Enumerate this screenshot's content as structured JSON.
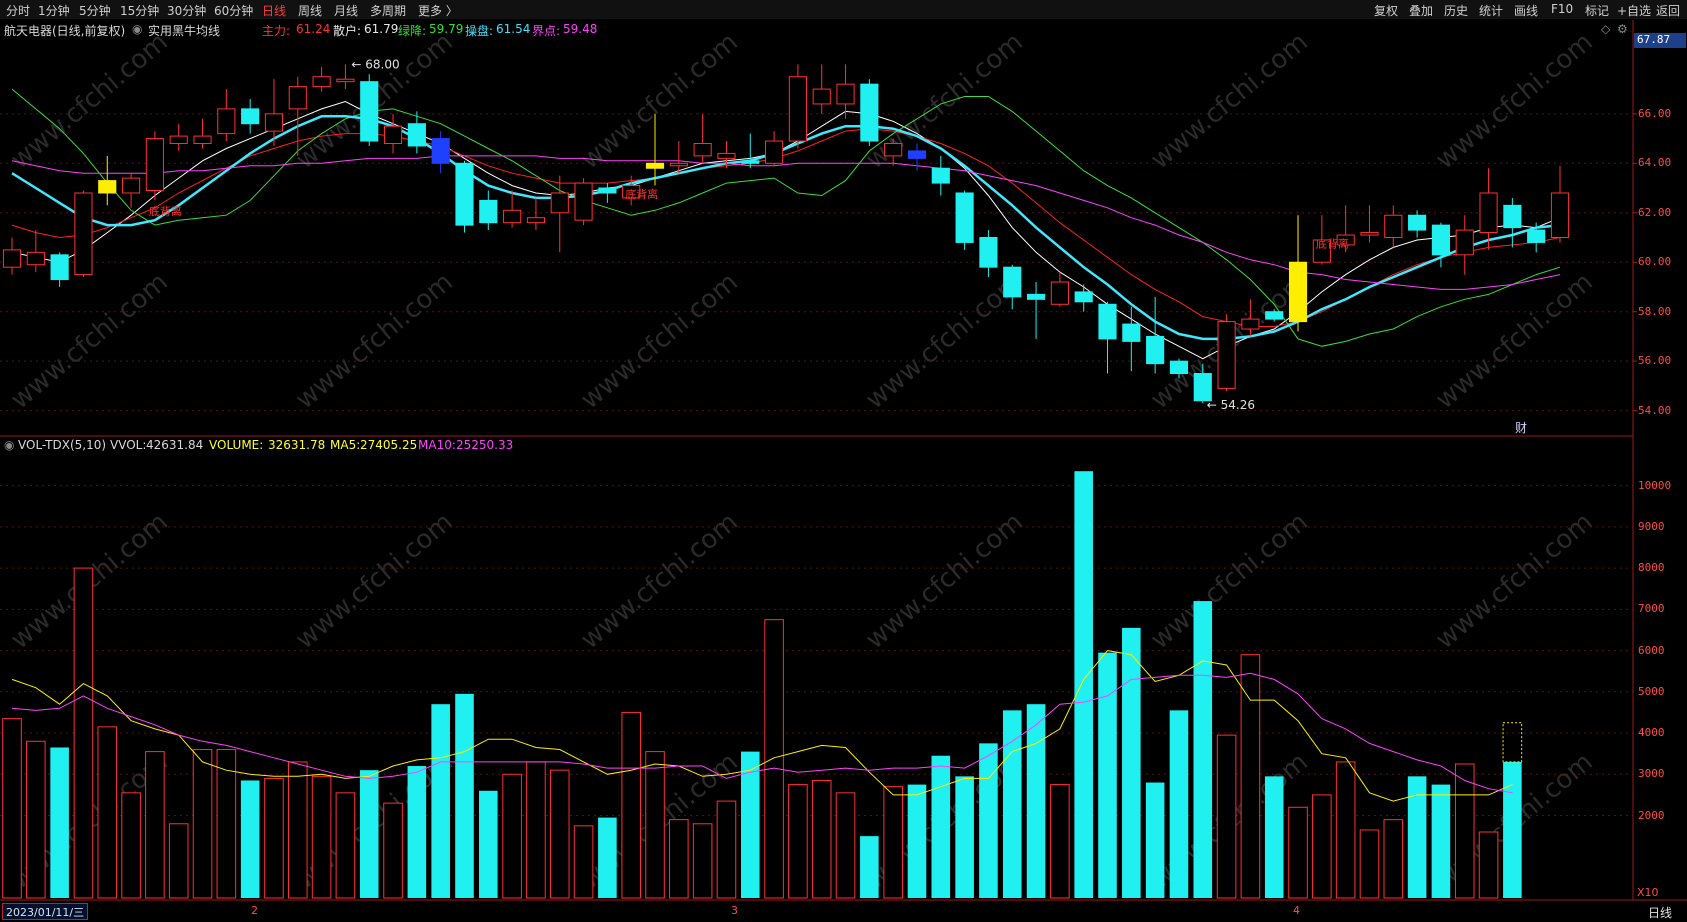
{
  "toolbar": {
    "periods": [
      "分时",
      "1分钟",
      "5分钟",
      "15分钟",
      "30分钟",
      "60分钟",
      "日线",
      "周线",
      "月线",
      "多周期",
      "更多 〉"
    ],
    "active_period": "日线",
    "right_buttons": [
      "复权",
      "叠加",
      "历史",
      "统计",
      "画线",
      "F10",
      "标记",
      "+自选",
      "返回"
    ]
  },
  "info": {
    "stock": "航天电器(日线,前复权)",
    "indicator": "实用黑牛均线",
    "zhuli_label": "主力:",
    "zhuli": "61.24",
    "sanhu_label": "散户:",
    "sanhu": "61.79",
    "lvjiang_label": "绿降:",
    "lvjiang": "59.79",
    "caopan_label": "操盘:",
    "caopan": "61.54",
    "jiedian_label": "界点:",
    "jiedian": "59.48"
  },
  "price_axis": {
    "last_price": "67.87",
    "ticks": [
      "66.00",
      "64.00",
      "62.00",
      "60.00",
      "58.00",
      "56.00",
      "54.00"
    ],
    "high_label": "68.00",
    "low_label": "54.26",
    "cai_badge": "财"
  },
  "signals": [
    "底背离",
    "底背离",
    "底背离"
  ],
  "volume": {
    "title": "VOL-TDX(5,10)",
    "vvol_label": "VVOL:",
    "vvol": "42631.84",
    "volume_label": "VOLUME:",
    "volume_value": "32631.78",
    "ma5_label": "MA5:",
    "ma5": "27405.25",
    "ma10_label": "MA10:",
    "ma10": "25250.33",
    "ticks": [
      "10000",
      "9000",
      "8000",
      "7000",
      "6000",
      "5000",
      "4000",
      "3000",
      "2000"
    ],
    "unit": "X10"
  },
  "xaxis": {
    "date": "2023/01/11/三",
    "months": [
      "2",
      "3",
      "4"
    ]
  },
  "period_label": "日线",
  "watermark": "www.cfchi.com",
  "chart_data": {
    "type": "candlestick",
    "title": "航天电器(日线,前复权)",
    "ylim": [
      53.5,
      68.5
    ],
    "candles": [
      {
        "o": 59.8,
        "c": 60.5,
        "h": 61.0,
        "l": 59.5
      },
      {
        "o": 59.9,
        "c": 60.4,
        "h": 61.3,
        "l": 59.6
      },
      {
        "o": 60.3,
        "c": 59.3,
        "h": 60.4,
        "l": 59.0
      },
      {
        "o": 59.5,
        "c": 62.8,
        "h": 62.9,
        "l": 59.4
      },
      {
        "o": 62.8,
        "c": 63.3,
        "h": 64.3,
        "l": 62.3
      },
      {
        "o": 62.8,
        "c": 63.4,
        "h": 63.6,
        "l": 62.2
      },
      {
        "o": 62.9,
        "c": 65.0,
        "h": 65.3,
        "l": 62.5
      },
      {
        "o": 64.8,
        "c": 65.1,
        "h": 65.6,
        "l": 64.5
      },
      {
        "o": 64.8,
        "c": 65.1,
        "h": 65.8,
        "l": 64.6
      },
      {
        "o": 65.2,
        "c": 66.2,
        "h": 67.0,
        "l": 64.9
      },
      {
        "o": 66.2,
        "c": 65.6,
        "h": 66.6,
        "l": 65.2
      },
      {
        "o": 65.3,
        "c": 66.0,
        "h": 67.4,
        "l": 64.7
      },
      {
        "o": 66.2,
        "c": 67.1,
        "h": 67.5,
        "l": 64.3
      },
      {
        "o": 67.1,
        "c": 67.5,
        "h": 67.9,
        "l": 66.9
      },
      {
        "o": 67.3,
        "c": 67.4,
        "h": 68.0,
        "l": 67.0
      },
      {
        "o": 67.3,
        "c": 64.9,
        "h": 67.6,
        "l": 64.7
      },
      {
        "o": 64.8,
        "c": 65.5,
        "h": 66.0,
        "l": 64.4
      },
      {
        "o": 65.6,
        "c": 64.7,
        "h": 66.1,
        "l": 64.4
      },
      {
        "o": 65.0,
        "c": 64.0,
        "h": 65.3,
        "l": 63.6
      },
      {
        "o": 64.0,
        "c": 61.5,
        "h": 64.1,
        "l": 61.2
      },
      {
        "o": 62.5,
        "c": 61.6,
        "h": 62.9,
        "l": 61.3
      },
      {
        "o": 61.6,
        "c": 62.1,
        "h": 62.9,
        "l": 61.4
      },
      {
        "o": 61.6,
        "c": 61.8,
        "h": 62.6,
        "l": 61.3
      },
      {
        "o": 62.0,
        "c": 62.8,
        "h": 63.5,
        "l": 60.4
      },
      {
        "o": 61.7,
        "c": 63.2,
        "h": 63.4,
        "l": 61.5
      },
      {
        "o": 63.0,
        "c": 62.8,
        "h": 63.2,
        "l": 62.4
      },
      {
        "o": 62.6,
        "c": 63.1,
        "h": 63.5,
        "l": 62.3
      },
      {
        "o": 63.8,
        "c": 64.0,
        "h": 66.0,
        "l": 63.1
      },
      {
        "o": 63.9,
        "c": 64.0,
        "h": 64.9,
        "l": 63.6
      },
      {
        "o": 64.3,
        "c": 64.8,
        "h": 66.0,
        "l": 64.0
      },
      {
        "o": 64.2,
        "c": 64.4,
        "h": 64.9,
        "l": 63.8
      },
      {
        "o": 64.1,
        "c": 64.0,
        "h": 65.2,
        "l": 63.8
      },
      {
        "o": 64.0,
        "c": 64.9,
        "h": 65.3,
        "l": 63.9
      },
      {
        "o": 64.9,
        "c": 67.5,
        "h": 68.0,
        "l": 64.6
      },
      {
        "o": 66.4,
        "c": 67.0,
        "h": 68.0,
        "l": 66.0
      },
      {
        "o": 66.4,
        "c": 67.2,
        "h": 68.0,
        "l": 65.8
      },
      {
        "o": 67.2,
        "c": 64.9,
        "h": 67.4,
        "l": 64.7
      },
      {
        "o": 64.3,
        "c": 64.8,
        "h": 65.0,
        "l": 63.9
      },
      {
        "o": 64.5,
        "c": 64.2,
        "h": 64.8,
        "l": 63.7
      },
      {
        "o": 63.8,
        "c": 63.2,
        "h": 64.3,
        "l": 62.7
      },
      {
        "o": 62.8,
        "c": 60.8,
        "h": 62.9,
        "l": 60.5
      },
      {
        "o": 61.0,
        "c": 59.8,
        "h": 61.3,
        "l": 59.4
      },
      {
        "o": 59.8,
        "c": 58.6,
        "h": 59.9,
        "l": 58.1
      },
      {
        "o": 58.7,
        "c": 58.5,
        "h": 59.2,
        "l": 56.9
      },
      {
        "o": 58.3,
        "c": 59.2,
        "h": 59.6,
        "l": 58.2
      },
      {
        "o": 58.8,
        "c": 58.4,
        "h": 59.1,
        "l": 58.0
      },
      {
        "o": 58.3,
        "c": 56.9,
        "h": 58.4,
        "l": 55.5
      },
      {
        "o": 57.5,
        "c": 56.8,
        "h": 58.2,
        "l": 55.6
      },
      {
        "o": 57.0,
        "c": 55.9,
        "h": 58.6,
        "l": 55.5
      },
      {
        "o": 56.0,
        "c": 55.5,
        "h": 56.1,
        "l": 55.3
      },
      {
        "o": 55.5,
        "c": 54.4,
        "h": 55.9,
        "l": 54.3
      },
      {
        "o": 54.9,
        "c": 57.6,
        "h": 57.9,
        "l": 54.8
      },
      {
        "o": 57.3,
        "c": 57.7,
        "h": 58.5,
        "l": 57.0
      },
      {
        "o": 58.0,
        "c": 57.7,
        "h": 58.1,
        "l": 57.6
      },
      {
        "o": 57.6,
        "c": 60.0,
        "h": 61.9,
        "l": 57.2
      },
      {
        "o": 60.0,
        "c": 60.9,
        "h": 61.9,
        "l": 59.9
      },
      {
        "o": 60.7,
        "c": 61.1,
        "h": 62.3,
        "l": 60.4
      },
      {
        "o": 61.1,
        "c": 61.2,
        "h": 62.3,
        "l": 60.8
      },
      {
        "o": 61.0,
        "c": 61.9,
        "h": 62.3,
        "l": 60.6
      },
      {
        "o": 61.9,
        "c": 61.3,
        "h": 62.1,
        "l": 61.0
      },
      {
        "o": 61.5,
        "c": 60.3,
        "h": 61.6,
        "l": 59.8
      },
      {
        "o": 60.3,
        "c": 61.3,
        "h": 61.9,
        "l": 59.5
      },
      {
        "o": 61.2,
        "c": 62.8,
        "h": 63.8,
        "l": 60.5
      },
      {
        "o": 62.3,
        "c": 61.4,
        "h": 62.6,
        "l": 60.6
      },
      {
        "o": 61.3,
        "c": 60.8,
        "h": 61.6,
        "l": 60.4
      },
      {
        "o": 61.0,
        "c": 62.8,
        "h": 63.9,
        "l": 60.8
      }
    ],
    "lines": [
      {
        "name": "主力",
        "color": "#ffffff",
        "values": [
          60.4,
          60.2,
          60.0,
          60.5,
          61.2,
          61.9,
          62.7,
          63.4,
          64.1,
          64.6,
          65.0,
          65.4,
          65.8,
          66.2,
          66.5,
          66.0,
          65.6,
          65.2,
          64.8,
          64.2,
          63.6,
          63.1,
          62.8,
          62.7,
          62.8,
          63.0,
          63.1,
          63.4,
          63.7,
          64.0,
          64.1,
          64.2,
          64.4,
          64.9,
          65.5,
          66.1,
          66.0,
          65.7,
          65.2,
          64.6,
          63.8,
          62.7,
          61.4,
          60.4,
          59.6,
          59.0,
          58.3,
          57.7,
          57.1,
          56.6,
          56.1,
          56.6,
          57.0,
          57.3,
          58.0,
          58.8,
          59.5,
          60.1,
          60.6,
          60.9,
          61.0,
          61.1,
          61.4,
          61.5,
          61.4,
          61.8
        ]
      },
      {
        "name": "散户",
        "color": "#ff2020",
        "values": [
          61.5,
          61.2,
          61.0,
          61.1,
          61.4,
          61.8,
          62.2,
          62.8,
          63.3,
          63.8,
          64.3,
          64.6,
          64.9,
          65.1,
          65.2,
          65.2,
          65.1,
          64.9,
          64.7,
          64.3,
          63.9,
          63.6,
          63.4,
          63.2,
          63.2,
          63.2,
          63.3,
          63.4,
          63.6,
          63.8,
          63.9,
          64.0,
          64.2,
          64.5,
          64.9,
          65.3,
          65.4,
          65.3,
          65.1,
          64.8,
          64.4,
          63.9,
          63.2,
          62.4,
          61.6,
          60.9,
          60.2,
          59.5,
          58.9,
          58.4,
          57.8,
          57.6,
          57.4,
          57.4,
          57.6,
          58.0,
          58.5,
          59.0,
          59.5,
          59.9,
          60.2,
          60.4,
          60.6,
          60.7,
          60.8,
          61.0
        ]
      },
      {
        "name": "绿降",
        "color": "#3cdc3c",
        "values": [
          67.0,
          66.2,
          65.4,
          64.4,
          63.2,
          62.1,
          61.5,
          61.7,
          61.8,
          61.9,
          62.5,
          63.5,
          64.5,
          65.2,
          65.8,
          66.1,
          66.2,
          65.9,
          65.6,
          65.1,
          64.6,
          64.1,
          63.5,
          62.9,
          62.5,
          62.2,
          61.9,
          62.1,
          62.4,
          62.8,
          63.2,
          63.3,
          63.4,
          62.8,
          62.7,
          63.3,
          64.5,
          65.2,
          65.8,
          66.4,
          66.7,
          66.7,
          66.1,
          65.3,
          64.5,
          63.7,
          63.1,
          62.6,
          62.0,
          61.4,
          60.8,
          60.1,
          59.3,
          58.3,
          56.9,
          56.6,
          56.8,
          57.1,
          57.3,
          57.8,
          58.2,
          58.5,
          58.7,
          59.1,
          59.5,
          59.8
        ]
      },
      {
        "name": "操盘",
        "color": "#40e8ff",
        "values": [
          63.6,
          63.0,
          62.4,
          61.8,
          61.5,
          61.5,
          61.7,
          62.3,
          63.0,
          63.7,
          64.4,
          65.0,
          65.5,
          65.9,
          65.9,
          65.8,
          65.5,
          65.0,
          64.4,
          63.7,
          63.1,
          62.8,
          62.6,
          62.6,
          62.7,
          62.9,
          63.2,
          63.4,
          63.6,
          63.8,
          64.0,
          64.1,
          64.4,
          64.8,
          65.2,
          65.5,
          65.5,
          65.4,
          65.1,
          64.6,
          63.9,
          63.1,
          62.3,
          61.4,
          60.6,
          59.8,
          59.1,
          58.3,
          57.6,
          57.1,
          56.9,
          56.9,
          57.0,
          57.2,
          57.6,
          58.1,
          58.5,
          59.0,
          59.4,
          59.8,
          60.2,
          60.6,
          60.9,
          61.1,
          61.4,
          61.5
        ]
      },
      {
        "name": "界点",
        "color": "#ff40ff",
        "values": [
          64.1,
          63.9,
          63.7,
          63.6,
          63.6,
          63.6,
          63.6,
          63.7,
          63.7,
          63.8,
          63.9,
          63.9,
          64.0,
          64.0,
          64.1,
          64.2,
          64.2,
          64.2,
          64.3,
          64.3,
          64.3,
          64.3,
          64.3,
          64.2,
          64.2,
          64.1,
          64.1,
          64.1,
          64.1,
          64.0,
          64.0,
          63.9,
          63.9,
          64.0,
          64.0,
          64.0,
          64.0,
          64.0,
          63.9,
          63.8,
          63.7,
          63.5,
          63.3,
          63.1,
          62.8,
          62.5,
          62.2,
          61.8,
          61.5,
          61.1,
          60.8,
          60.4,
          60.1,
          59.9,
          59.6,
          59.5,
          59.3,
          59.2,
          59.1,
          59.0,
          58.9,
          58.9,
          59.0,
          59.1,
          59.3,
          59.5
        ]
      }
    ],
    "volume_ylim": [
      0,
      10500
    ],
    "volume_values": [
      4350,
      3800,
      3650,
      8000,
      4150,
      2550,
      3550,
      1800,
      3600,
      3600,
      2850,
      2900,
      3300,
      2950,
      2550,
      3100,
      2300,
      3200,
      4700,
      4950,
      2600,
      3000,
      3300,
      3100,
      1750,
      1950,
      4500,
      3550,
      1900,
      1800,
      2350,
      3550,
      6750,
      2750,
      2850,
      2550,
      1500,
      2700,
      2750,
      3450,
      2950,
      3750,
      4550,
      4700,
      2750,
      10350,
      5950,
      6550,
      2800,
      4550,
      7200,
      3950,
      5900,
      2950,
      2200,
      2500,
      3300,
      1650,
      1900,
      2950,
      2750,
      3250,
      1600,
      3300
    ],
    "volume_ma5": [
      5300,
      5100,
      4700,
      5200,
      4900,
      4300,
      4100,
      3950,
      3300,
      3100,
      3000,
      2950,
      2950,
      3000,
      2900,
      2950,
      3200,
      3350,
      3400,
      3550,
      3850,
      3850,
      3650,
      3600,
      3300,
      3000,
      3100,
      3250,
      3200,
      2950,
      3000,
      3100,
      3400,
      3550,
      3700,
      3650,
      3050,
      2500,
      2500,
      2700,
      2900,
      2900,
      3550,
      3750,
      4100,
      5300,
      6000,
      5900,
      5250,
      5400,
      5750,
      5650,
      4800,
      4800,
      4300,
      3500,
      3400,
      2550,
      2350,
      2500,
      2500,
      2500,
      2500,
      2750
    ],
    "volume_ma10": [
      4600,
      4550,
      4600,
      4900,
      4600,
      4400,
      4200,
      3950,
      3800,
      3700,
      3550,
      3400,
      3250,
      3100,
      2950,
      2900,
      2950,
      3050,
      3300,
      3300,
      3300,
      3300,
      3300,
      3300,
      3250,
      3150,
      3150,
      3150,
      3200,
      3200,
      2900,
      3050,
      3150,
      3050,
      3100,
      3150,
      3100,
      3150,
      3150,
      3200,
      3150,
      3450,
      3800,
      4200,
      4700,
      4750,
      4900,
      5300,
      5350,
      5400,
      5400,
      5350,
      5450,
      5300,
      4950,
      4350,
      4100,
      3750,
      3550,
      3350,
      3200,
      2850,
      2650,
      2550
    ]
  }
}
